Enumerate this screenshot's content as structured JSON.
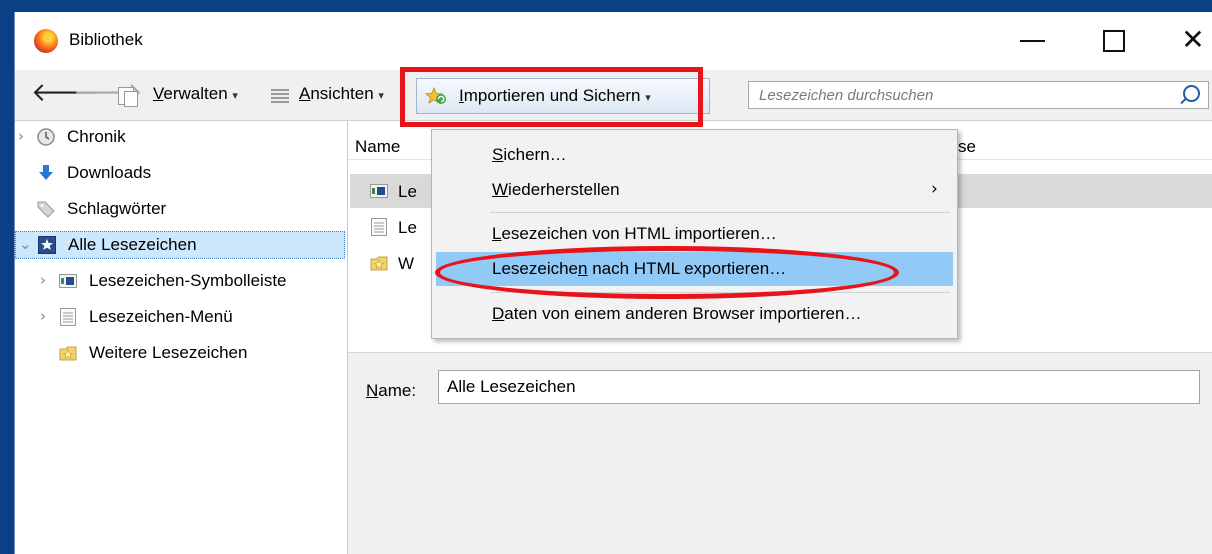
{
  "window": {
    "title": "Bibliothek",
    "app_icon": "firefox-icon",
    "buttons": {
      "minimize_icon": "minimize-icon",
      "maximize_icon": "maximize-icon",
      "close_glyph": "✕"
    }
  },
  "toolbar": {
    "back_icon": "back-arrow-icon",
    "forward_icon": "forward-arrow-icon",
    "manage": {
      "underline": "V",
      "rest": "erwalten",
      "arrow": "▾"
    },
    "views": {
      "underline": "A",
      "rest": "nsichten",
      "arrow": "▾"
    },
    "import_backup": {
      "underline": "I",
      "rest": "mportieren und Sichern",
      "arrow": "▾"
    },
    "search": {
      "placeholder": "Lesezeichen durchsuchen",
      "icon": "search-icon"
    }
  },
  "sidebar": {
    "items": [
      {
        "label": "Chronik",
        "icon": "history-clock-icon",
        "twisty": "›"
      },
      {
        "label": "Downloads",
        "icon": "download-arrow-icon",
        "twisty": ""
      },
      {
        "label": "Schlagwörter",
        "icon": "tag-icon",
        "twisty": ""
      },
      {
        "label": "Alle Lesezeichen",
        "icon": "bookmarks-star-icon",
        "twisty": "⌄",
        "selected": true
      },
      {
        "label": "Lesezeichen-Symbolleiste",
        "icon": "bookmarks-toolbar-icon",
        "twisty": "›"
      },
      {
        "label": "Lesezeichen-Menü",
        "icon": "bookmarks-menu-icon",
        "twisty": "›"
      },
      {
        "label": "Weitere Lesezeichen",
        "icon": "other-bookmarks-folder-icon",
        "twisty": ""
      }
    ]
  },
  "list": {
    "columns": {
      "name": "Name",
      "address_partial": "se"
    },
    "rows": [
      {
        "label_partial": "Le",
        "icon": "bookmarks-toolbar-icon",
        "selected": true
      },
      {
        "label_partial": "Le",
        "icon": "bookmarks-menu-icon"
      },
      {
        "label_partial": "W",
        "icon": "other-bookmarks-folder-icon"
      }
    ]
  },
  "details": {
    "name_label": {
      "underline": "N",
      "rest": "ame:"
    },
    "name_value": "Alle Lesezeichen"
  },
  "menu": {
    "items": [
      {
        "underline": "S",
        "rest": "ichern…"
      },
      {
        "underline": "W",
        "rest": "iederherstellen",
        "submenu_arrow": "›"
      },
      {
        "underline": "L",
        "rest": "esezeichen von HTML importieren…"
      },
      {
        "pre": "Lesezeiche",
        "underline": "n",
        "rest": " nach HTML exportieren…",
        "highlighted": true
      },
      {
        "underline": "D",
        "rest": "aten von einem anderen Browser importieren…"
      }
    ]
  },
  "annotations": {
    "color": "#e8141b"
  }
}
